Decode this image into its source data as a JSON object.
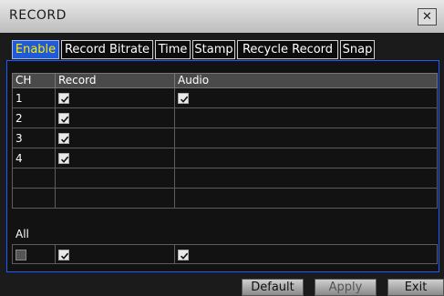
{
  "window": {
    "title": "RECORD",
    "close_icon": "close-icon"
  },
  "tabs": [
    {
      "label": "Enable",
      "active": true
    },
    {
      "label": "Record Bitrate",
      "active": false
    },
    {
      "label": "Time",
      "active": false
    },
    {
      "label": "Stamp",
      "active": false
    },
    {
      "label": "Recycle Record",
      "active": false
    },
    {
      "label": "Snap",
      "active": false
    }
  ],
  "table": {
    "headers": [
      "CH",
      "Record",
      "Audio"
    ],
    "rows": [
      {
        "ch": "1",
        "record": true,
        "audio": true
      },
      {
        "ch": "2",
        "record": true,
        "audio": false
      },
      {
        "ch": "3",
        "record": true,
        "audio": false
      },
      {
        "ch": "4",
        "record": true,
        "audio": false
      },
      {
        "ch": "",
        "record": null,
        "audio": null
      },
      {
        "ch": "",
        "record": null,
        "audio": null
      }
    ]
  },
  "all": {
    "label": "All",
    "select_all": false,
    "record": true,
    "audio": true
  },
  "footer": {
    "default_label": "Default",
    "apply_label": "Apply",
    "exit_label": "Exit",
    "apply_enabled": false
  },
  "colors": {
    "accent": "#1f5ad8",
    "active_tab_text": "#ffe800",
    "panel_border": "#1d5aff"
  }
}
